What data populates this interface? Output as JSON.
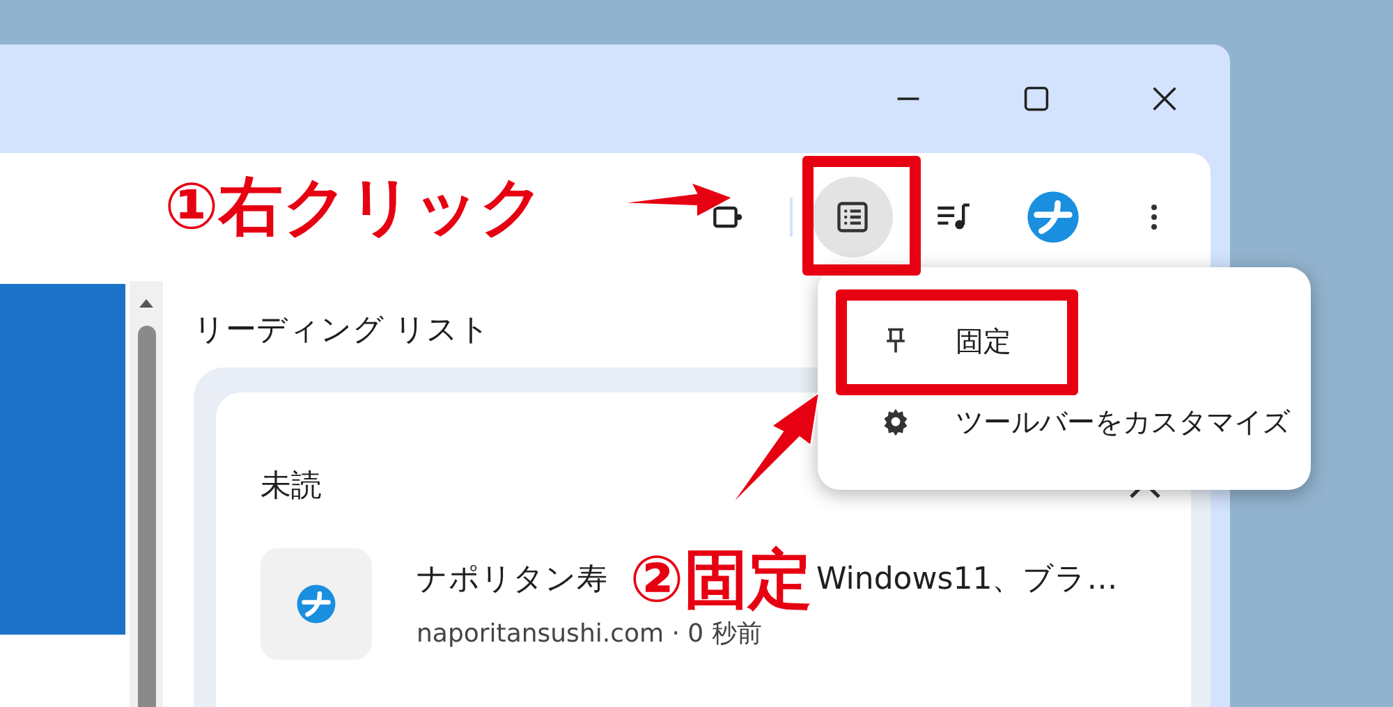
{
  "toolbar": {
    "buttons": [
      {
        "kind": "extension",
        "selected": false
      },
      {
        "kind": "reading_list",
        "selected": true
      },
      {
        "kind": "media",
        "selected": false
      },
      {
        "kind": "profile",
        "selected": false
      },
      {
        "kind": "more",
        "selected": false
      }
    ]
  },
  "side_panel": {
    "title": "リーディング リスト",
    "section": {
      "title": "未読",
      "expanded": true,
      "items": [
        {
          "title_start": "ナポリタン寿",
          "title_end": "Windows11、ブラ…",
          "source": "naporitansushi.com · 0 秒前"
        }
      ]
    }
  },
  "menu": {
    "items": [
      {
        "kind": "pin",
        "label": "固定"
      },
      {
        "kind": "gear",
        "label": "ツールバーをカスタマイズ"
      }
    ]
  },
  "annotations": [
    {
      "kind": "callout",
      "text": "①右クリック"
    },
    {
      "kind": "callout",
      "text": "②固定"
    }
  ]
}
